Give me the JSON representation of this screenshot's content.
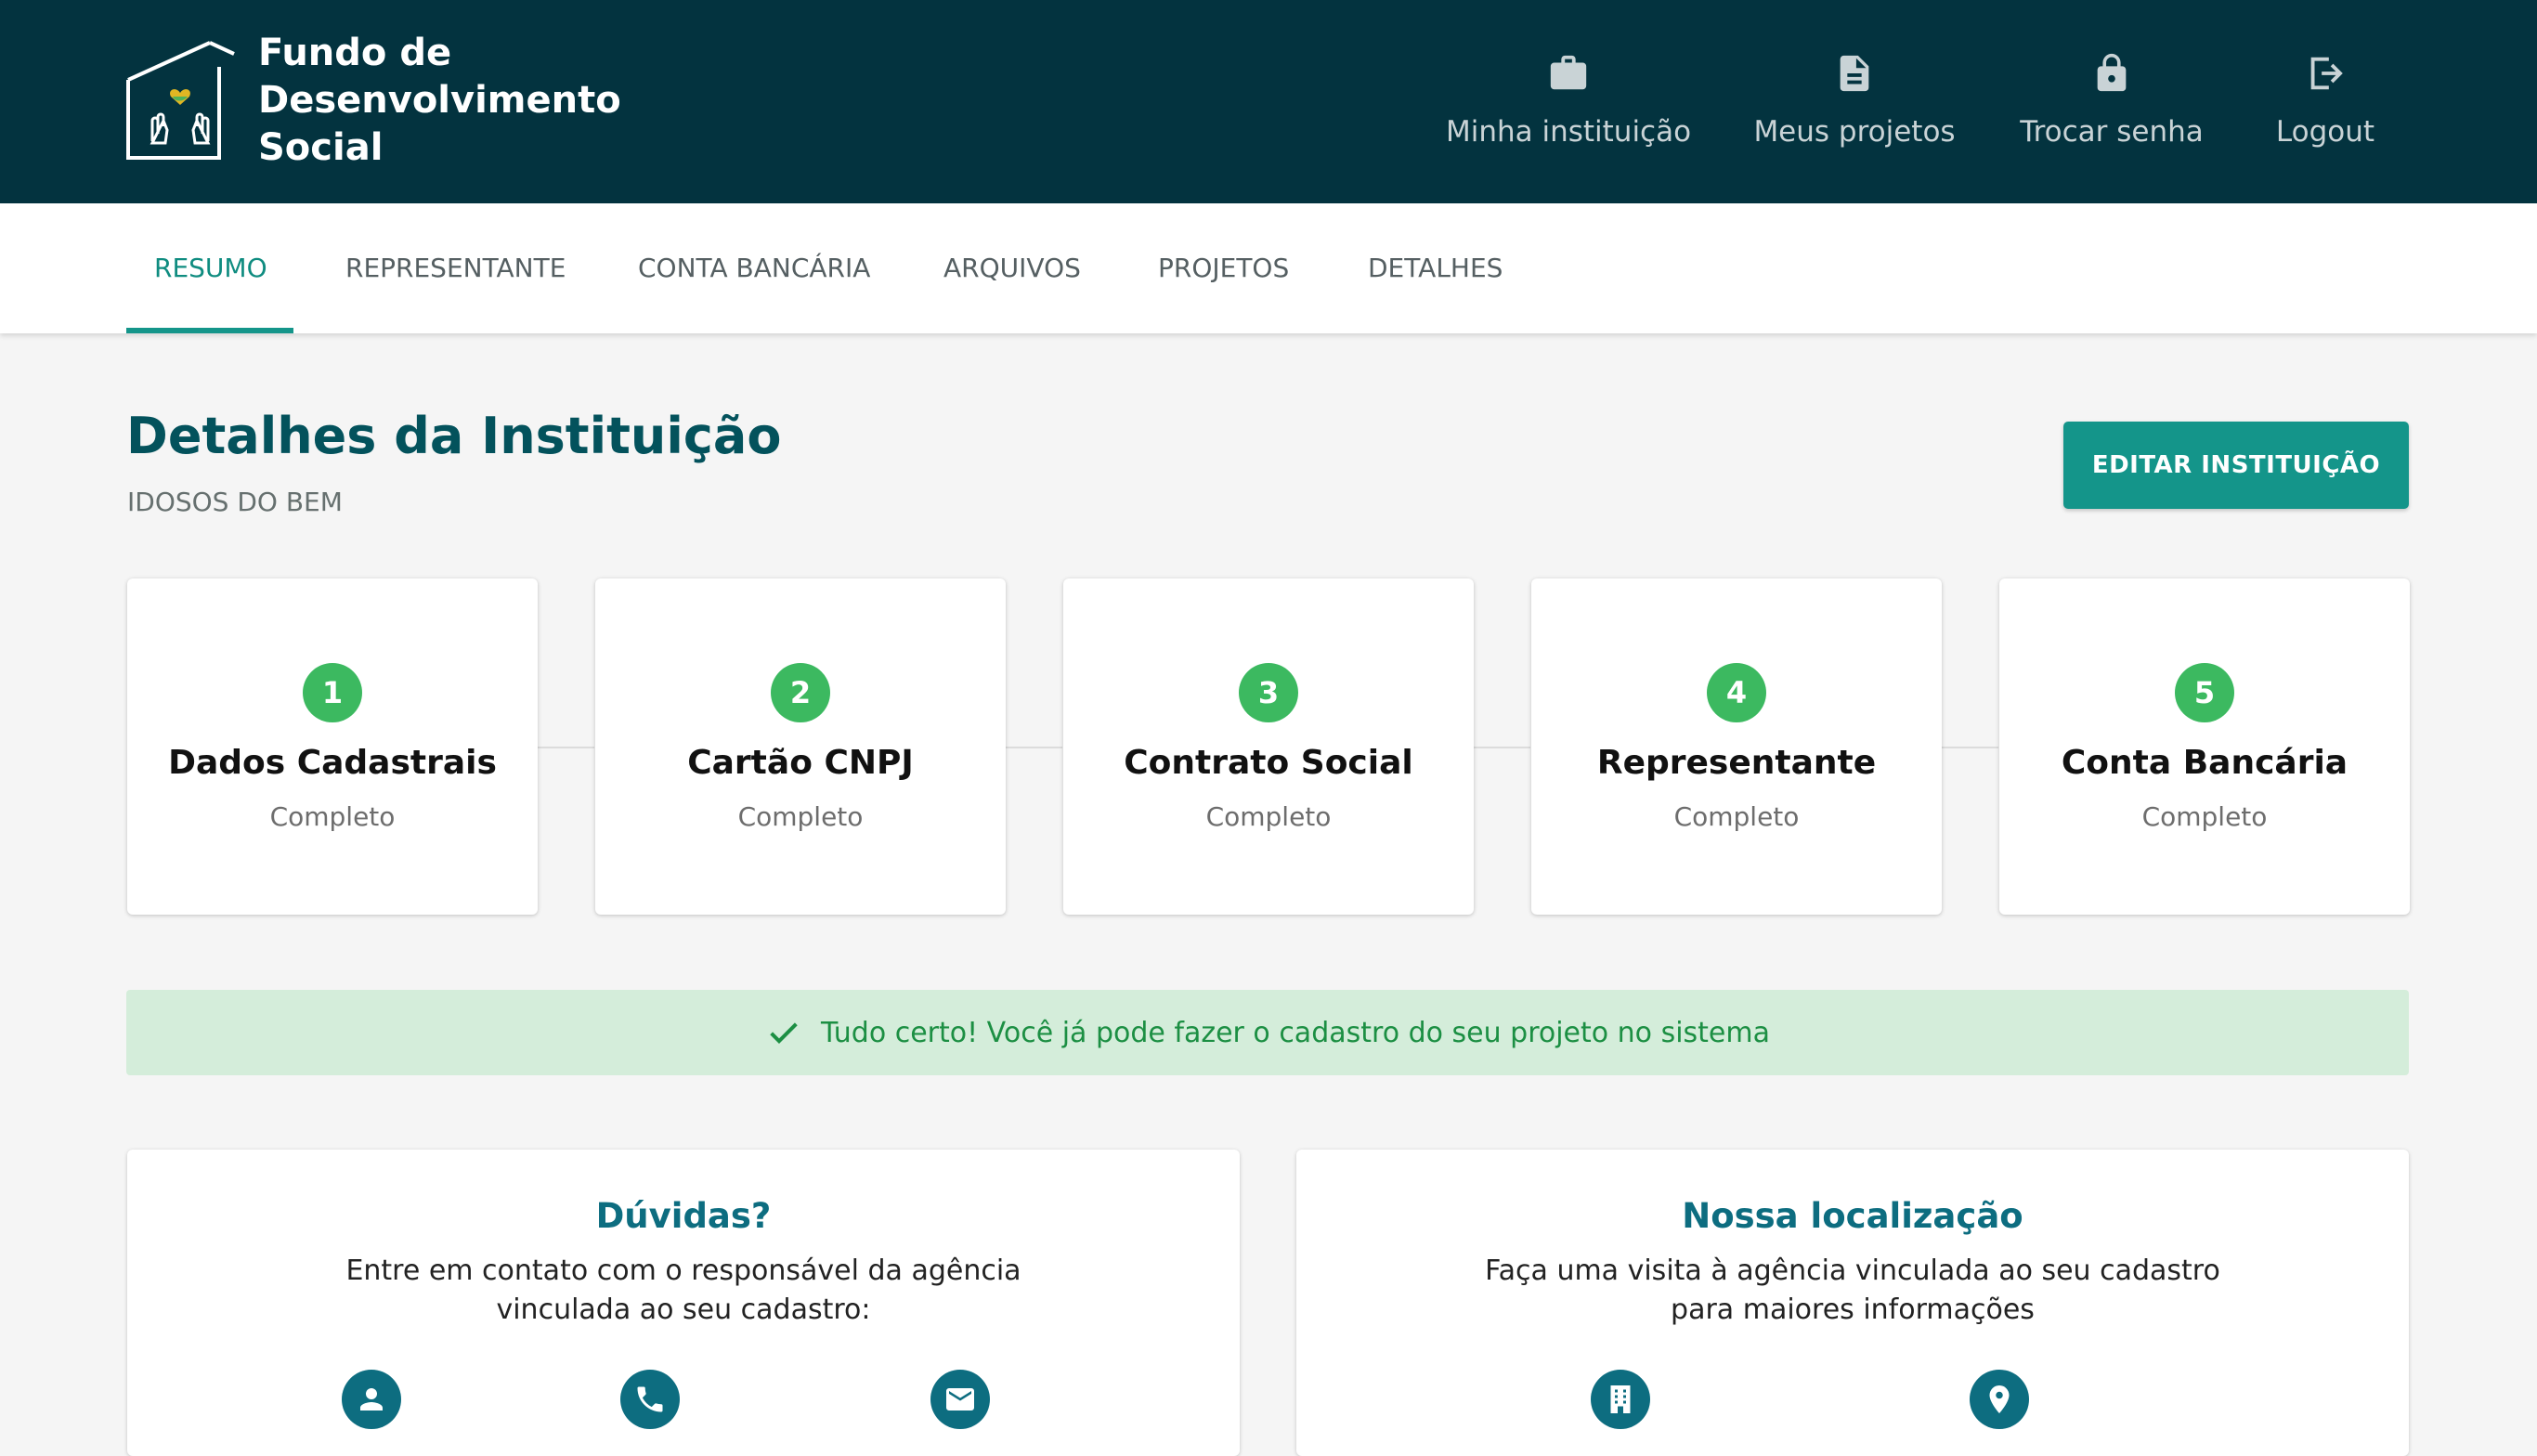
{
  "header": {
    "brand_lines": [
      "Fundo de",
      "Desenvolvimento",
      "Social"
    ],
    "nav": [
      {
        "label": "Minha instituição",
        "icon": "briefcase-icon"
      },
      {
        "label": "Meus projetos",
        "icon": "document-icon"
      },
      {
        "label": "Trocar senha",
        "icon": "lock-icon"
      },
      {
        "label": "Logout",
        "icon": "logout-icon"
      }
    ]
  },
  "tabs": [
    {
      "label": "RESUMO",
      "active": true
    },
    {
      "label": "REPRESENTANTE",
      "active": false
    },
    {
      "label": "CONTA BANCÁRIA",
      "active": false
    },
    {
      "label": "ARQUIVOS",
      "active": false
    },
    {
      "label": "PROJETOS",
      "active": false
    },
    {
      "label": "DETALHES",
      "active": false
    }
  ],
  "page": {
    "title": "Detalhes da Instituição",
    "institution_name": "IDOSOS DO BEM",
    "edit_button": "EDITAR INSTITUIÇÃO"
  },
  "steps": [
    {
      "number": "1",
      "title": "Dados Cadastrais",
      "status": "Completo"
    },
    {
      "number": "2",
      "title": "Cartão CNPJ",
      "status": "Completo"
    },
    {
      "number": "3",
      "title": "Contrato Social",
      "status": "Completo"
    },
    {
      "number": "4",
      "title": "Representante",
      "status": "Completo"
    },
    {
      "number": "5",
      "title": "Conta Bancária",
      "status": "Completo"
    }
  ],
  "alert": {
    "message": "Tudo certo! Você já pode fazer o cadastro do seu projeto no sistema",
    "icon": "check-icon"
  },
  "cards": {
    "doubts": {
      "title": "Dúvidas?",
      "text_lines": [
        "Entre em contato com o responsável da agência",
        "vinculada ao seu cadastro:"
      ],
      "icons": [
        "person-icon",
        "phone-icon",
        "email-icon"
      ]
    },
    "location": {
      "title": "Nossa localização",
      "text_lines": [
        "Faça uma visita à agência vinculada ao seu cadastro",
        "para maiores informações"
      ],
      "icons": [
        "building-icon",
        "location-pin-icon"
      ]
    }
  },
  "colors": {
    "header_bg": "#03333f",
    "accent": "#14958a",
    "step_green": "#3cb960",
    "alert_bg": "#d4edda",
    "alert_text": "#1c8f43",
    "card_title": "#0d6d80"
  }
}
